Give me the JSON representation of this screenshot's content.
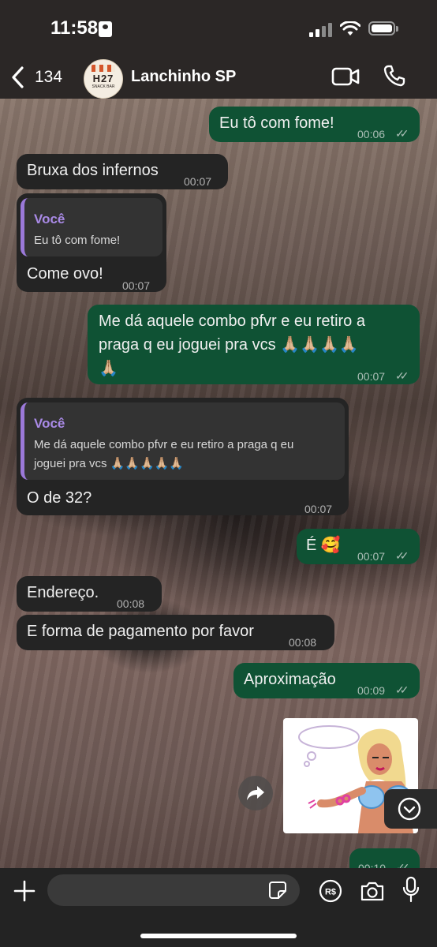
{
  "status_bar": {
    "time": "11:58"
  },
  "header": {
    "back_count": "134",
    "avatar_text": "H27",
    "avatar_subtext": "SNACK BAR",
    "title": "Lanchinho SP"
  },
  "messages": [
    {
      "dir": "out",
      "text": "Eu tô com fome!",
      "time": "00:06"
    },
    {
      "dir": "in",
      "text": "Bruxa dos infernos",
      "time": "00:07"
    },
    {
      "dir": "in",
      "quote_author": "Você",
      "quote_text": "Eu tô com fome!",
      "text": "Come ovo!",
      "time": "00:07"
    },
    {
      "dir": "out",
      "text_lines": [
        "Me dá aquele combo pfvr e eu retiro a",
        "praga q eu joguei pra vcs 🙏🏼🙏🏼🙏🏼🙏🏼",
        "🙏🏼"
      ],
      "time": "00:07"
    },
    {
      "dir": "in",
      "quote_author": "Você",
      "quote_lines": [
        "Me dá aquele combo pfvr e eu retiro a praga q eu",
        "joguei pra vcs 🙏🏼🙏🏼🙏🏼🙏🏼🙏🏼"
      ],
      "text": "O de 32?",
      "time": "00:07"
    },
    {
      "dir": "out",
      "text": "É 🥰",
      "time": "00:07"
    },
    {
      "dir": "in",
      "text": "Endereço.",
      "time": "00:08"
    },
    {
      "dir": "in",
      "text": "E forma de pagamento por favor",
      "time": "00:08"
    },
    {
      "dir": "out",
      "text": "Aproximação",
      "time": "00:09"
    },
    {
      "dir": "out",
      "type": "image",
      "time": "00:10"
    }
  ],
  "composer": {
    "placeholder": ""
  },
  "colors": {
    "outgoing_bubble": "#0f5234",
    "incoming_bubble": "#242424",
    "quote_accent": "#9b79d9"
  }
}
